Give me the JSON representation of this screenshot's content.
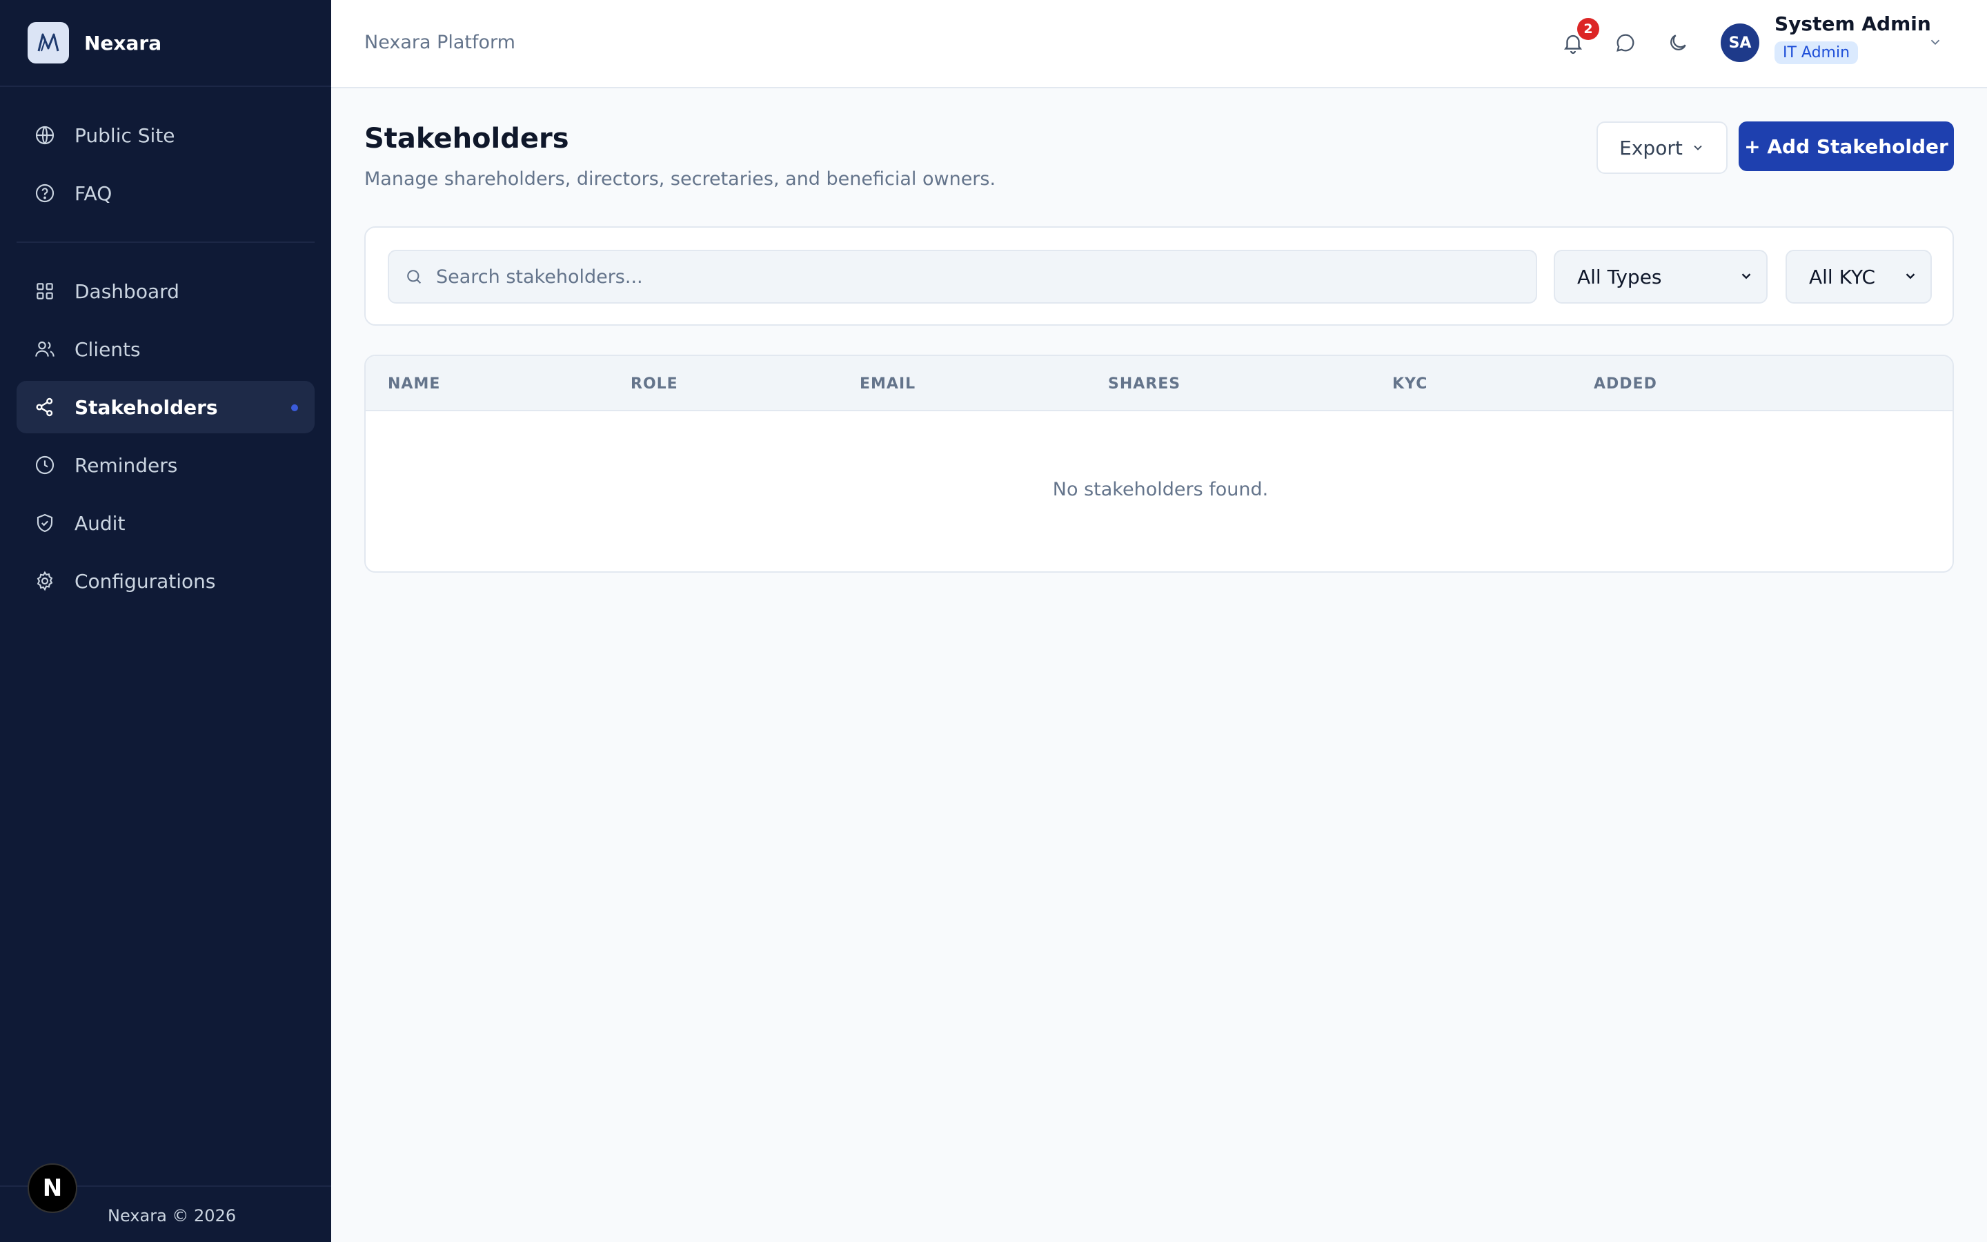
{
  "brand": {
    "name": "Nexara"
  },
  "sidebar": {
    "top_items": [
      {
        "label": "Public Site",
        "icon": "globe-icon"
      },
      {
        "label": "FAQ",
        "icon": "help-circle-icon"
      }
    ],
    "items": [
      {
        "label": "Dashboard",
        "icon": "grid-icon"
      },
      {
        "label": "Clients",
        "icon": "users-icon"
      },
      {
        "label": "Stakeholders",
        "icon": "share-icon",
        "active": true
      },
      {
        "label": "Reminders",
        "icon": "clock-icon"
      },
      {
        "label": "Audit",
        "icon": "shield-check-icon"
      },
      {
        "label": "Configurations",
        "icon": "gear-icon"
      }
    ],
    "footer": "Nexara © 2026",
    "badge_letter": "N"
  },
  "header": {
    "title": "Nexara Platform",
    "notification_count": "2",
    "user": {
      "initials": "SA",
      "name": "System Admin",
      "role": "IT Admin"
    }
  },
  "page": {
    "title": "Stakeholders",
    "subtitle": "Manage shareholders, directors, secretaries, and beneficial owners.",
    "export_label": "Export",
    "add_label": "+ Add Stakeholder"
  },
  "filters": {
    "search_placeholder": "Search stakeholders...",
    "type_selected": "All Types",
    "kyc_selected": "All KYC"
  },
  "table": {
    "columns": [
      "NAME",
      "ROLE",
      "EMAIL",
      "SHARES",
      "KYC",
      "ADDED"
    ],
    "empty_message": "No stakeholders found."
  },
  "colors": {
    "sidebar_bg": "#0f1a36",
    "primary": "#1e40af",
    "notification": "#dc2626",
    "page_bg": "#f8fafc"
  }
}
